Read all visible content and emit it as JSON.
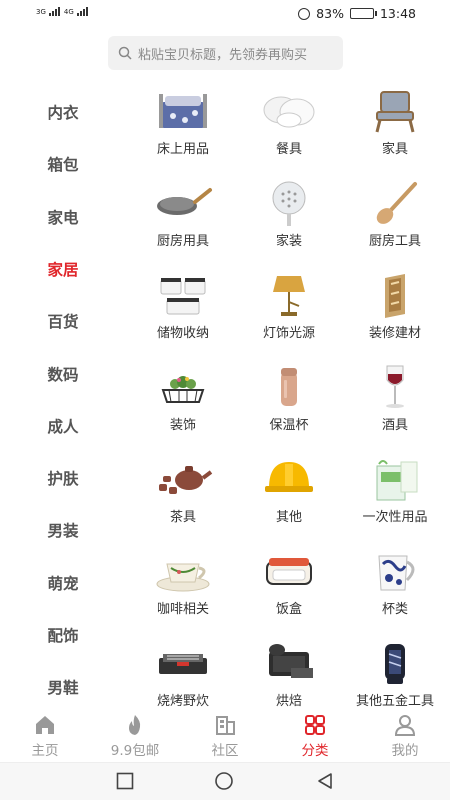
{
  "status": {
    "sim1": "3G",
    "sim2": "4G",
    "battery_percent": "83%",
    "battery_level": 0.83,
    "time": "13:48"
  },
  "search": {
    "placeholder": "粘贴宝贝标题，先领券再购买"
  },
  "sidebar": {
    "active": "家居",
    "items": [
      "内衣",
      "箱包",
      "家电",
      "家居",
      "百货",
      "数码",
      "成人",
      "护肤",
      "男装",
      "萌宠",
      "配饰",
      "男鞋"
    ]
  },
  "grid": {
    "items": [
      {
        "label": "床上用品",
        "icon": "bed-icon"
      },
      {
        "label": "餐具",
        "icon": "tableware-icon"
      },
      {
        "label": "家具",
        "icon": "chair-icon"
      },
      {
        "label": "厨房用具",
        "icon": "pan-icon"
      },
      {
        "label": "家装",
        "icon": "showerhead-icon"
      },
      {
        "label": "厨房工具",
        "icon": "spatula-icon"
      },
      {
        "label": "储物收纳",
        "icon": "container-icon"
      },
      {
        "label": "灯饰光源",
        "icon": "lamp-icon"
      },
      {
        "label": "装修建材",
        "icon": "wall-panel-icon"
      },
      {
        "label": "装饰",
        "icon": "planter-icon"
      },
      {
        "label": "保温杯",
        "icon": "thermos-icon"
      },
      {
        "label": "酒具",
        "icon": "wine-glass-icon"
      },
      {
        "label": "茶具",
        "icon": "teapot-icon"
      },
      {
        "label": "其他",
        "icon": "helmet-icon"
      },
      {
        "label": "一次性用品",
        "icon": "gloves-box-icon"
      },
      {
        "label": "咖啡相关",
        "icon": "coffee-cup-icon"
      },
      {
        "label": "饭盒",
        "icon": "lunchbox-icon"
      },
      {
        "label": "杯类",
        "icon": "mug-icon"
      },
      {
        "label": "烧烤野炊",
        "icon": "grill-icon"
      },
      {
        "label": "烘焙",
        "icon": "baking-tray-icon"
      },
      {
        "label": "其他五金工具",
        "icon": "tool-icon"
      }
    ]
  },
  "tabbar": {
    "active": "分类",
    "tabs": [
      {
        "label": "主页",
        "icon": "home-icon"
      },
      {
        "label": "9.9包邮",
        "icon": "flame-icon"
      },
      {
        "label": "社区",
        "icon": "building-icon"
      },
      {
        "label": "分类",
        "icon": "category-grid-icon"
      },
      {
        "label": "我的",
        "icon": "user-icon"
      }
    ]
  },
  "colors": {
    "accent": "#e0262b",
    "inactive": "#999999",
    "search_bg": "#f1f1f1"
  }
}
